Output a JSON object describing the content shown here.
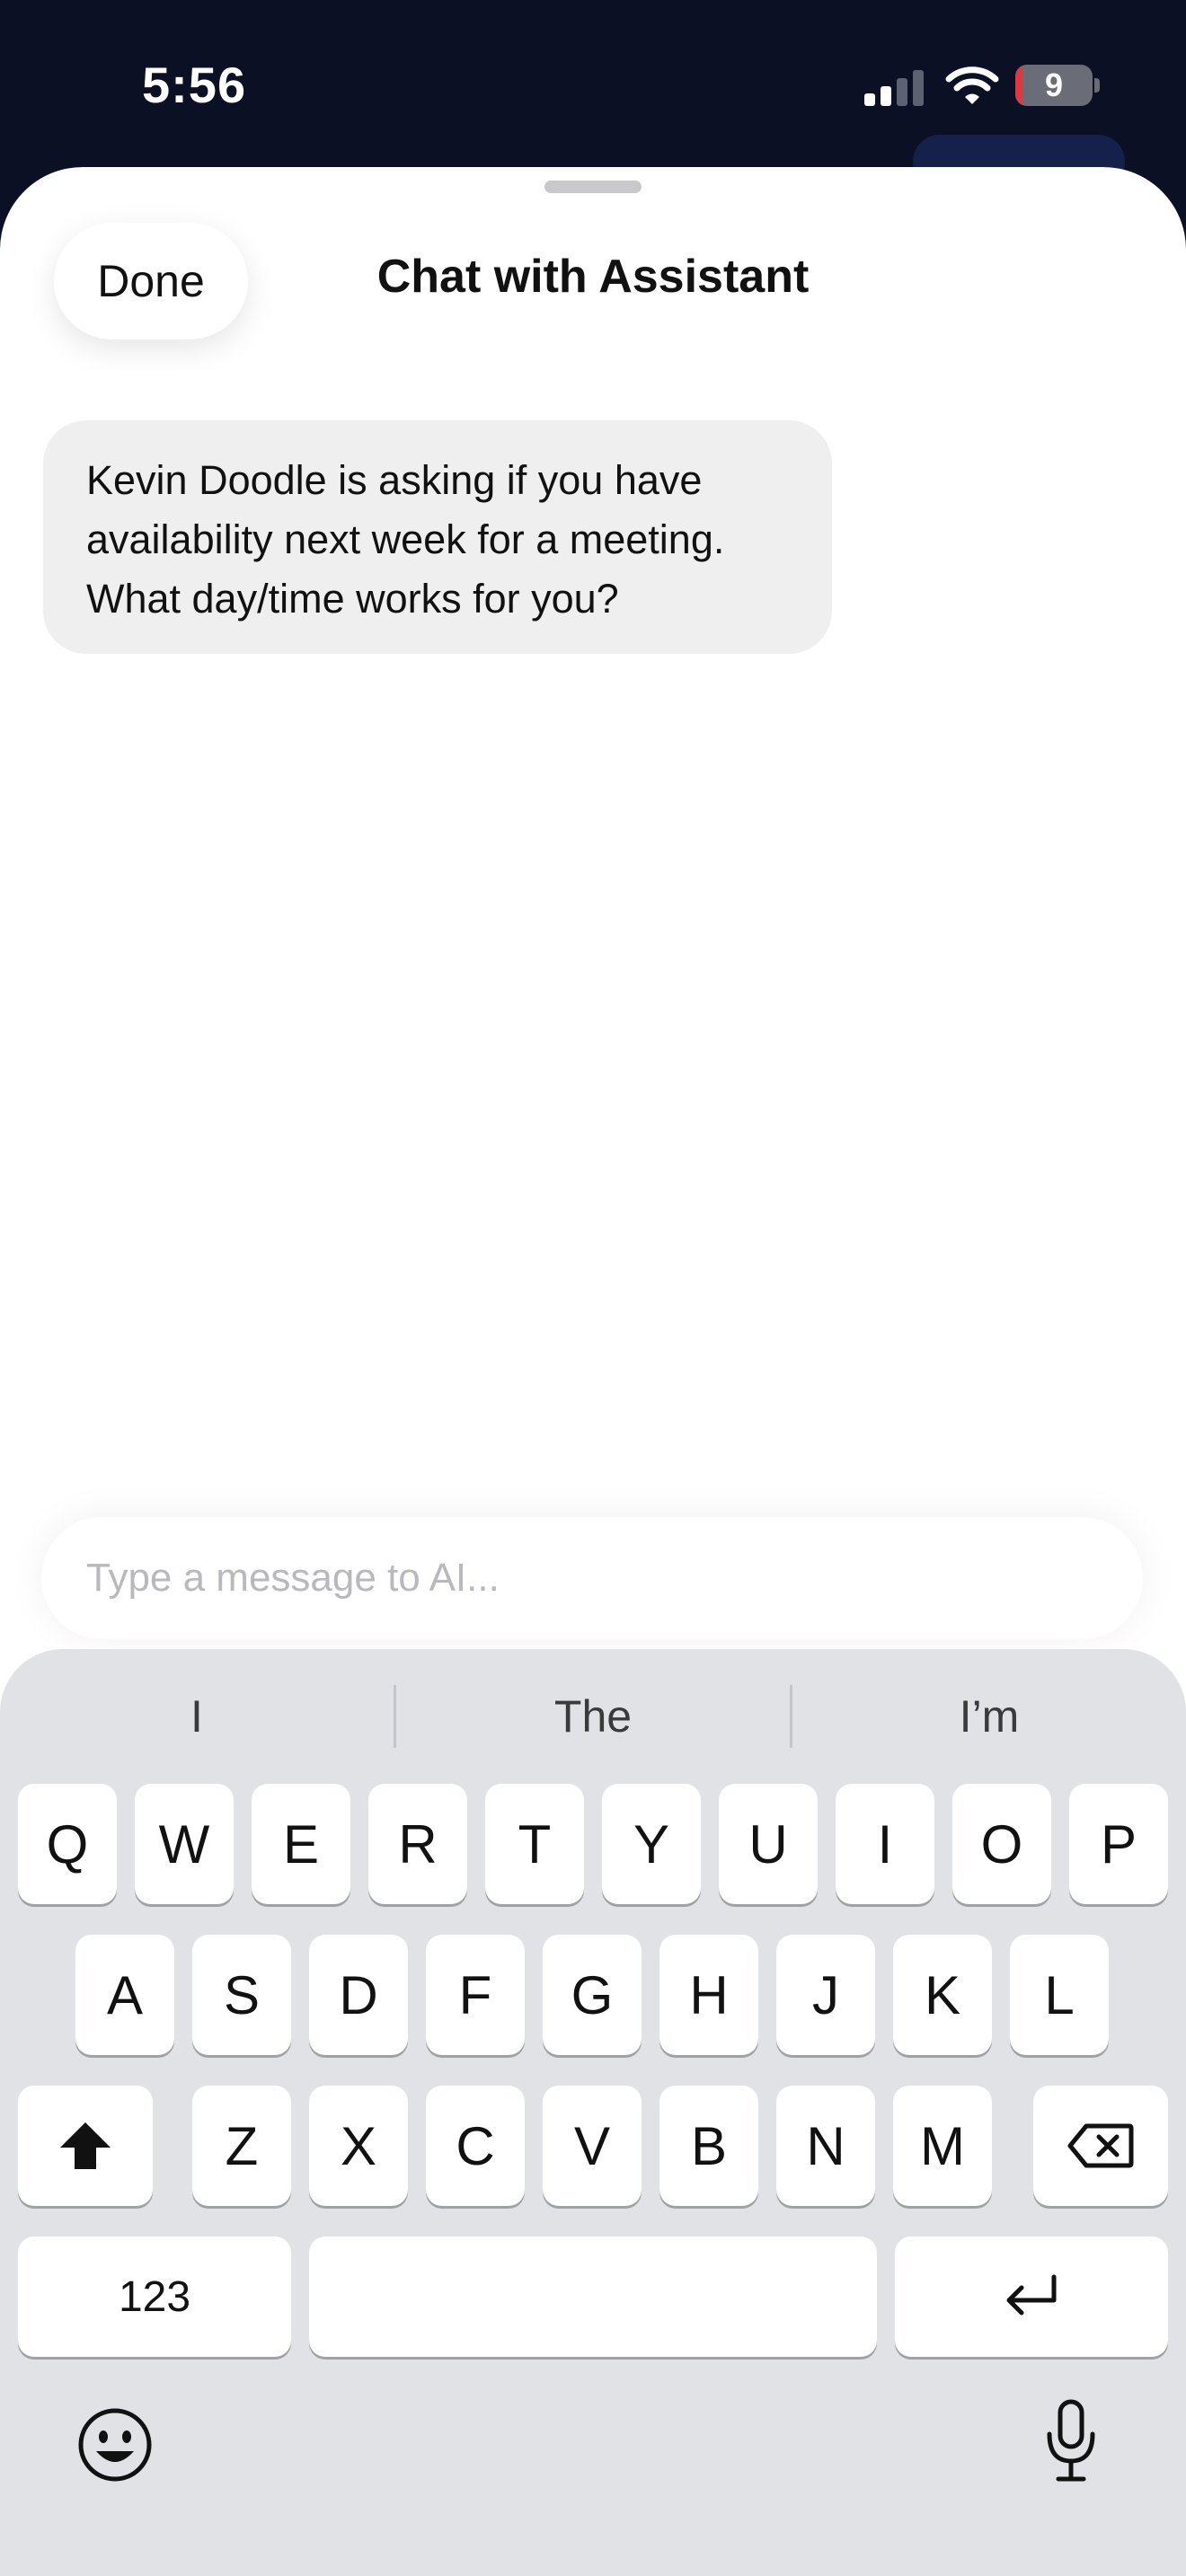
{
  "status_bar": {
    "time": "5:56",
    "battery_level": "9",
    "battery_percent": 9,
    "signal_bars_active": 2,
    "signal_bars_total": 4
  },
  "sheet": {
    "done_label": "Done",
    "title": "Chat with Assistant"
  },
  "messages": [
    {
      "sender": "assistant",
      "lines": [
        "Kevin Doodle is asking if you have",
        "availability next week for a meeting.",
        "What day/time works for you?"
      ]
    }
  ],
  "composer": {
    "placeholder": "Type a message to AI...",
    "value": ""
  },
  "keyboard": {
    "suggestions": [
      "I",
      "The",
      "I’m"
    ],
    "row1": [
      "Q",
      "W",
      "E",
      "R",
      "T",
      "Y",
      "U",
      "I",
      "O",
      "P"
    ],
    "row2": [
      "A",
      "S",
      "D",
      "F",
      "G",
      "H",
      "J",
      "K",
      "L"
    ],
    "row3": [
      "Z",
      "X",
      "C",
      "V",
      "B",
      "N",
      "M"
    ],
    "numbers_label": "123",
    "icons": {
      "shift": "shift-icon",
      "backspace": "backspace-icon",
      "return": "return-icon",
      "emoji": "emoji-icon",
      "dictation": "microphone-icon"
    }
  },
  "colors": {
    "background": "#0b1024",
    "sheet": "#ffffff",
    "bubble": "#efefef",
    "keyboard": "#e1e2e6",
    "battery_low": "#e0383e"
  }
}
